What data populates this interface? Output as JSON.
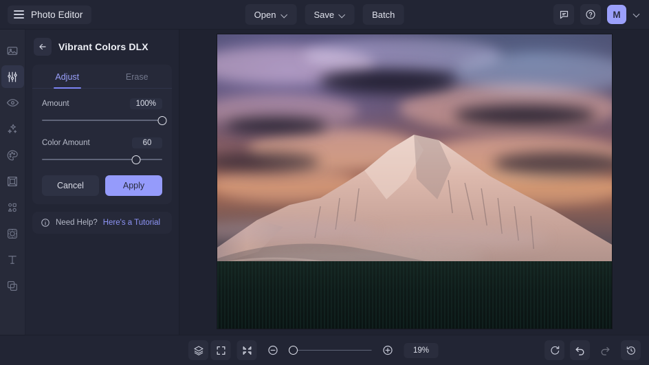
{
  "app": {
    "brand_title": "Photo Editor",
    "accent": "#959bfb",
    "panel_bg": "#222534",
    "canvas_bg": "#1f2230"
  },
  "topbar": {
    "menu_icon": "hamburger-icon",
    "buttons": [
      {
        "label": "Open",
        "has_dropdown": true,
        "name": "open-button"
      },
      {
        "label": "Save",
        "has_dropdown": true,
        "name": "save-button"
      },
      {
        "label": "Batch",
        "has_dropdown": false,
        "name": "batch-button"
      }
    ],
    "right": {
      "feedback_icon": "chat-bubble-icon",
      "help_icon": "question-mark-circle-icon",
      "avatar_initial": "M",
      "avatar_chevron": "chevron-down-icon"
    }
  },
  "sidebar": {
    "items": [
      {
        "name": "sidebar-item-image",
        "icon": "image-icon",
        "active": false
      },
      {
        "name": "sidebar-item-adjust",
        "icon": "sliders-icon",
        "active": true
      },
      {
        "name": "sidebar-item-retouch",
        "icon": "eye-icon",
        "active": false
      },
      {
        "name": "sidebar-item-effects",
        "icon": "sparkles-icon",
        "active": false
      },
      {
        "name": "sidebar-item-paint",
        "icon": "palette-icon",
        "active": false
      },
      {
        "name": "sidebar-item-frames",
        "icon": "frame-icon",
        "active": false
      },
      {
        "name": "sidebar-item-shapes",
        "icon": "shapes-icon",
        "active": false
      },
      {
        "name": "sidebar-item-stickers",
        "icon": "sticker-icon",
        "active": false
      },
      {
        "name": "sidebar-item-text",
        "icon": "text-icon",
        "active": false
      },
      {
        "name": "sidebar-item-layers",
        "icon": "layers-copy-icon",
        "active": false
      }
    ]
  },
  "panel": {
    "back_icon": "arrow-left-icon",
    "title": "Vibrant Colors DLX",
    "tabs": [
      {
        "label": "Adjust",
        "active": true
      },
      {
        "label": "Erase",
        "active": false
      }
    ],
    "sliders": [
      {
        "label": "Amount",
        "value": "100%",
        "percent": 100
      },
      {
        "label": "Color Amount",
        "value": "60",
        "percent": 78
      }
    ],
    "cancel_label": "Cancel",
    "apply_label": "Apply",
    "help": {
      "icon": "info-circle-icon",
      "text": "Need Help?",
      "link_text": "Here's a Tutorial"
    }
  },
  "canvas": {
    "image_alt": "Snow-capped mountain at sunset with orange clouds and dark forest"
  },
  "bottombar": {
    "left_tools": [
      {
        "name": "layers-panel-button",
        "icon": "layers-stack-icon",
        "filled": true
      },
      {
        "name": "compare-button",
        "icon": "compare-split-icon",
        "filled": false
      },
      {
        "name": "grid-view-button",
        "icon": "grid-four-icon",
        "filled": false
      }
    ],
    "view_tools": [
      {
        "name": "fit-to-screen-button",
        "icon": "expand-frame-icon",
        "filled": true
      },
      {
        "name": "actual-size-button",
        "icon": "collapse-arrows-icon",
        "filled": true
      }
    ],
    "zoom_out_icon": "minus-circle-icon",
    "zoom_in_icon": "plus-circle-icon",
    "zoom_percent": 19,
    "zoom_label": "19%",
    "right_tools": [
      {
        "name": "reset-button",
        "icon": "refresh-icon",
        "filled": true,
        "dimmed": false
      },
      {
        "name": "undo-button",
        "icon": "undo-arrow-icon",
        "filled": true,
        "dimmed": false
      },
      {
        "name": "redo-button",
        "icon": "redo-arrow-icon",
        "filled": false,
        "dimmed": true
      },
      {
        "name": "history-button",
        "icon": "clock-history-icon",
        "filled": true,
        "dimmed": false
      }
    ]
  }
}
